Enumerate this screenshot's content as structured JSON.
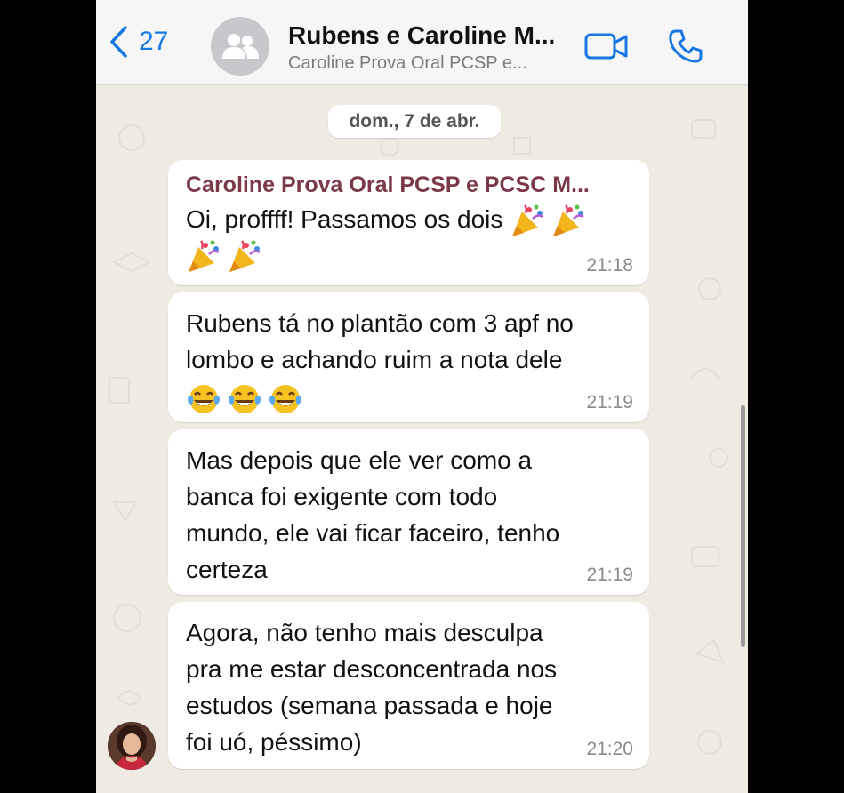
{
  "header": {
    "back_count": "27",
    "title": "Rubens e Caroline M...",
    "subtitle": "Caroline Prova Oral PCSP e..."
  },
  "date_separator": "dom., 7 de abr.",
  "messages": [
    {
      "sender": "Caroline Prova Oral PCSP e PCSC M...",
      "text": "Oi, proffff! Passamos os dois",
      "emoji": [
        "party-popper",
        "party-popper",
        "party-popper",
        "party-popper"
      ],
      "time": "21:18"
    },
    {
      "line1": "Rubens tá no plantão com 3 apf no",
      "line2": "lombo e achando ruim a nota dele",
      "emoji": [
        "tears-of-joy",
        "tears-of-joy",
        "tears-of-joy"
      ],
      "time": "21:19"
    },
    {
      "line1": "Mas depois que ele ver como a",
      "line2": "banca foi exigente com todo",
      "line3": "mundo, ele vai ficar faceiro, tenho",
      "line4": "certeza",
      "time": "21:19"
    },
    {
      "line1": "Agora, não tenho mais desculpa",
      "line2": "pra me estar desconcentrada nos",
      "line3": "estudos (semana passada e hoje",
      "line4": "foi uó, péssimo)",
      "time": "21:20"
    }
  ],
  "colors": {
    "accent": "#1677e5",
    "sender_name": "#7a3848",
    "chat_background": "#efeae2",
    "bubble": "#ffffff"
  }
}
